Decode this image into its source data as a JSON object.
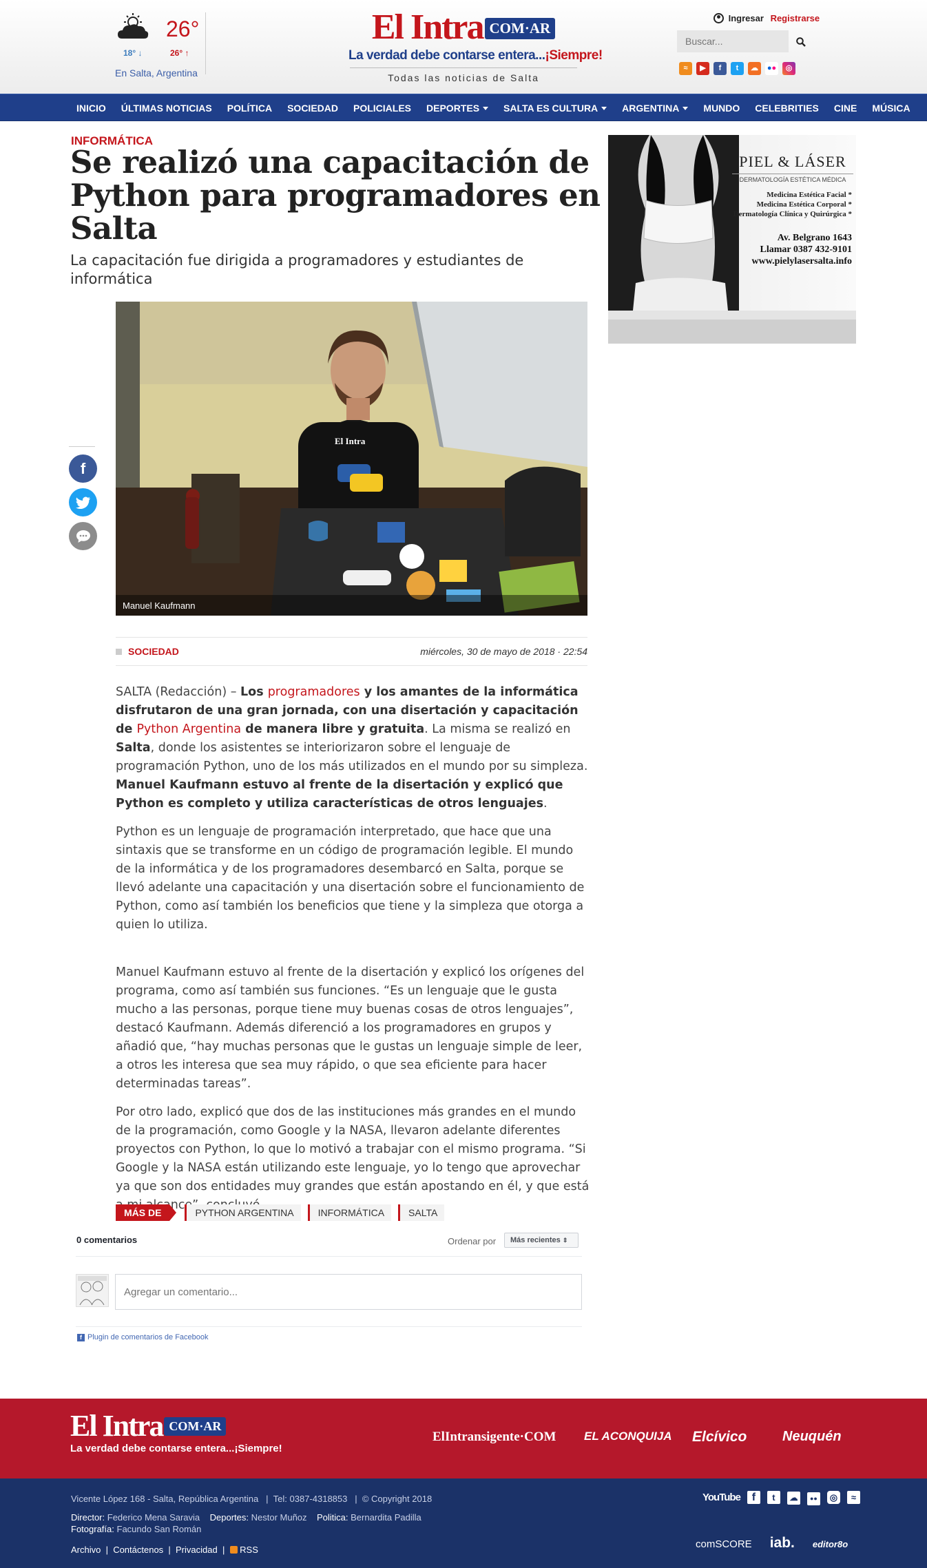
{
  "header": {
    "weather": {
      "temp": "26°",
      "min": "18°",
      "max": "26°",
      "location": "En Salta, Argentina"
    },
    "logo": {
      "name": "El Intra",
      "domain": "COM·AR",
      "tagline": "La verdad debe contarse entera...",
      "tagline_accent": "¡Siempre!",
      "subtitle": "Todas las noticias de Salta"
    },
    "login": "Ingresar",
    "register": "Registrarse",
    "search_placeholder": "Buscar...",
    "social_icons": [
      "rss-icon",
      "youtube-icon",
      "facebook-icon",
      "twitter-icon",
      "soundcloud-icon",
      "flickr-icon",
      "instagram-icon"
    ]
  },
  "nav": [
    "INICIO",
    "ÚLTIMAS NOTICIAS",
    "POLÍTICA",
    "SOCIEDAD",
    "POLICIALES",
    "DEPORTES",
    "SALTA ES CULTURA",
    "ARGENTINA",
    "MUNDO",
    "CELEBRITIES",
    "CINE",
    "MÚSICA"
  ],
  "article": {
    "kicker": "INFORMÁTICA",
    "title": "Se realizó una capacitación de Python para programadores en Salta",
    "subtitle": "La capacitación fue dirigida a programadores y estudiantes de informática",
    "photo_caption": "Manuel Kaufmann",
    "section": "SOCIEDAD",
    "date": "miércoles, 30 de mayo de 2018 · 22:54",
    "p1": {
      "a": "SALTA (Redacción) – ",
      "b": "Los ",
      "link1": "programadores",
      "c": " y los amantes de la informática disfrutaron de una gran jornada, con una disertación y capacitación de ",
      "link2": "Python Argentina",
      "d": " de manera libre y gratuita",
      "e": ". La misma se realizó en ",
      "f": "Salta",
      "g": ", donde los asistentes se interiorizaron sobre el lenguaje de programación Python, uno de los más utilizados en el mundo por su simpleza. ",
      "h": "Manuel Kaufmann estuvo al frente de la disertación y explicó que Python es completo y utiliza características de otros lenguajes",
      "i": "."
    },
    "p2": "Python es un lenguaje de programación interpretado, que hace que una sintaxis que se transforme en un código de programación legible. El mundo de la informática y de los programadores desembarcó en Salta, porque se llevó adelante una capacitación y una disertación sobre el funcionamiento de Python, como así también los beneficios que tiene y la simpleza que otorga a quien lo utiliza.",
    "p3": "Manuel Kaufmann estuvo al frente de la disertación y explicó los orígenes del programa, como así también sus funciones. “Es un lenguaje que le gusta mucho a las personas, porque tiene muy buenas cosas de otros lenguajes”, destacó Kaufmann. Además diferenció a los programadores en grupos y añadió que, “hay muchas personas que le gustas un lenguaje simple de leer, a otros les interesa que sea muy rápido, o que sea eficiente para hacer determinadas tareas”.",
    "p4": "Por otro lado, explicó que dos de las instituciones más grandes en el mundo de la programación, como Google y la NASA, llevaron adelante diferentes proyectos con Python, lo que lo motivó a trabajar con el mismo programa. “Si Google y la NASA están utilizando este lenguaje, yo lo tengo que aprovechar ya que son dos entidades muy grandes que están apostando en él, y que está a mi alcance”, concluyó.",
    "mas_de": "MÁS DE",
    "tags": [
      "PYTHON ARGENTINA",
      "INFORMÁTICA",
      "SALTA"
    ]
  },
  "comments": {
    "count": "0 comentarios",
    "order_label": "Ordenar por",
    "order_value": "Más recientes",
    "placeholder": "Agregar un comentario...",
    "plugin": "Plugin de comentarios de Facebook"
  },
  "ad": {
    "brand": "PIEL & LÁSER",
    "subtitle": "DERMATOLOGÍA ESTÉTICA MÉDICA",
    "services": [
      "Medicina Estética Facial *",
      "Medicina Estética Corporal *",
      "Dermatología Clínica y Quirúrgica *"
    ],
    "address": "Av. Belgrano 1643",
    "phone": "Llamar 0387 432-9101",
    "web": "www.pielylasersalta.info"
  },
  "footer": {
    "partners": [
      "ElIntransigente·COM",
      "EL ACONQUIJA",
      "Elcívico",
      "Neuquén"
    ],
    "address": "Vicente López 168 - Salta, República Argentina",
    "tel": "Tel: 0387-4318853",
    "copyright": "© Copyright 2018",
    "staff": [
      {
        "role": "Director:",
        "name": "Federico Mena Saravia"
      },
      {
        "role": "Deportes:",
        "name": "Nestor Muñoz"
      },
      {
        "role": "Politica:",
        "name": "Bernardita Padilla"
      },
      {
        "role": "Fotografía:",
        "name": "Facundo San Román"
      }
    ],
    "links": [
      "Archivo",
      "Contáctenos",
      "Privacidad",
      "RSS"
    ],
    "brands": [
      "comSCORE",
      "iab.",
      "editor8o"
    ]
  },
  "colors": {
    "brand_red": "#c4161c",
    "brand_blue": "#1f3f8a",
    "footer_red": "#b5182b",
    "footer_blue": "#1b3268"
  }
}
